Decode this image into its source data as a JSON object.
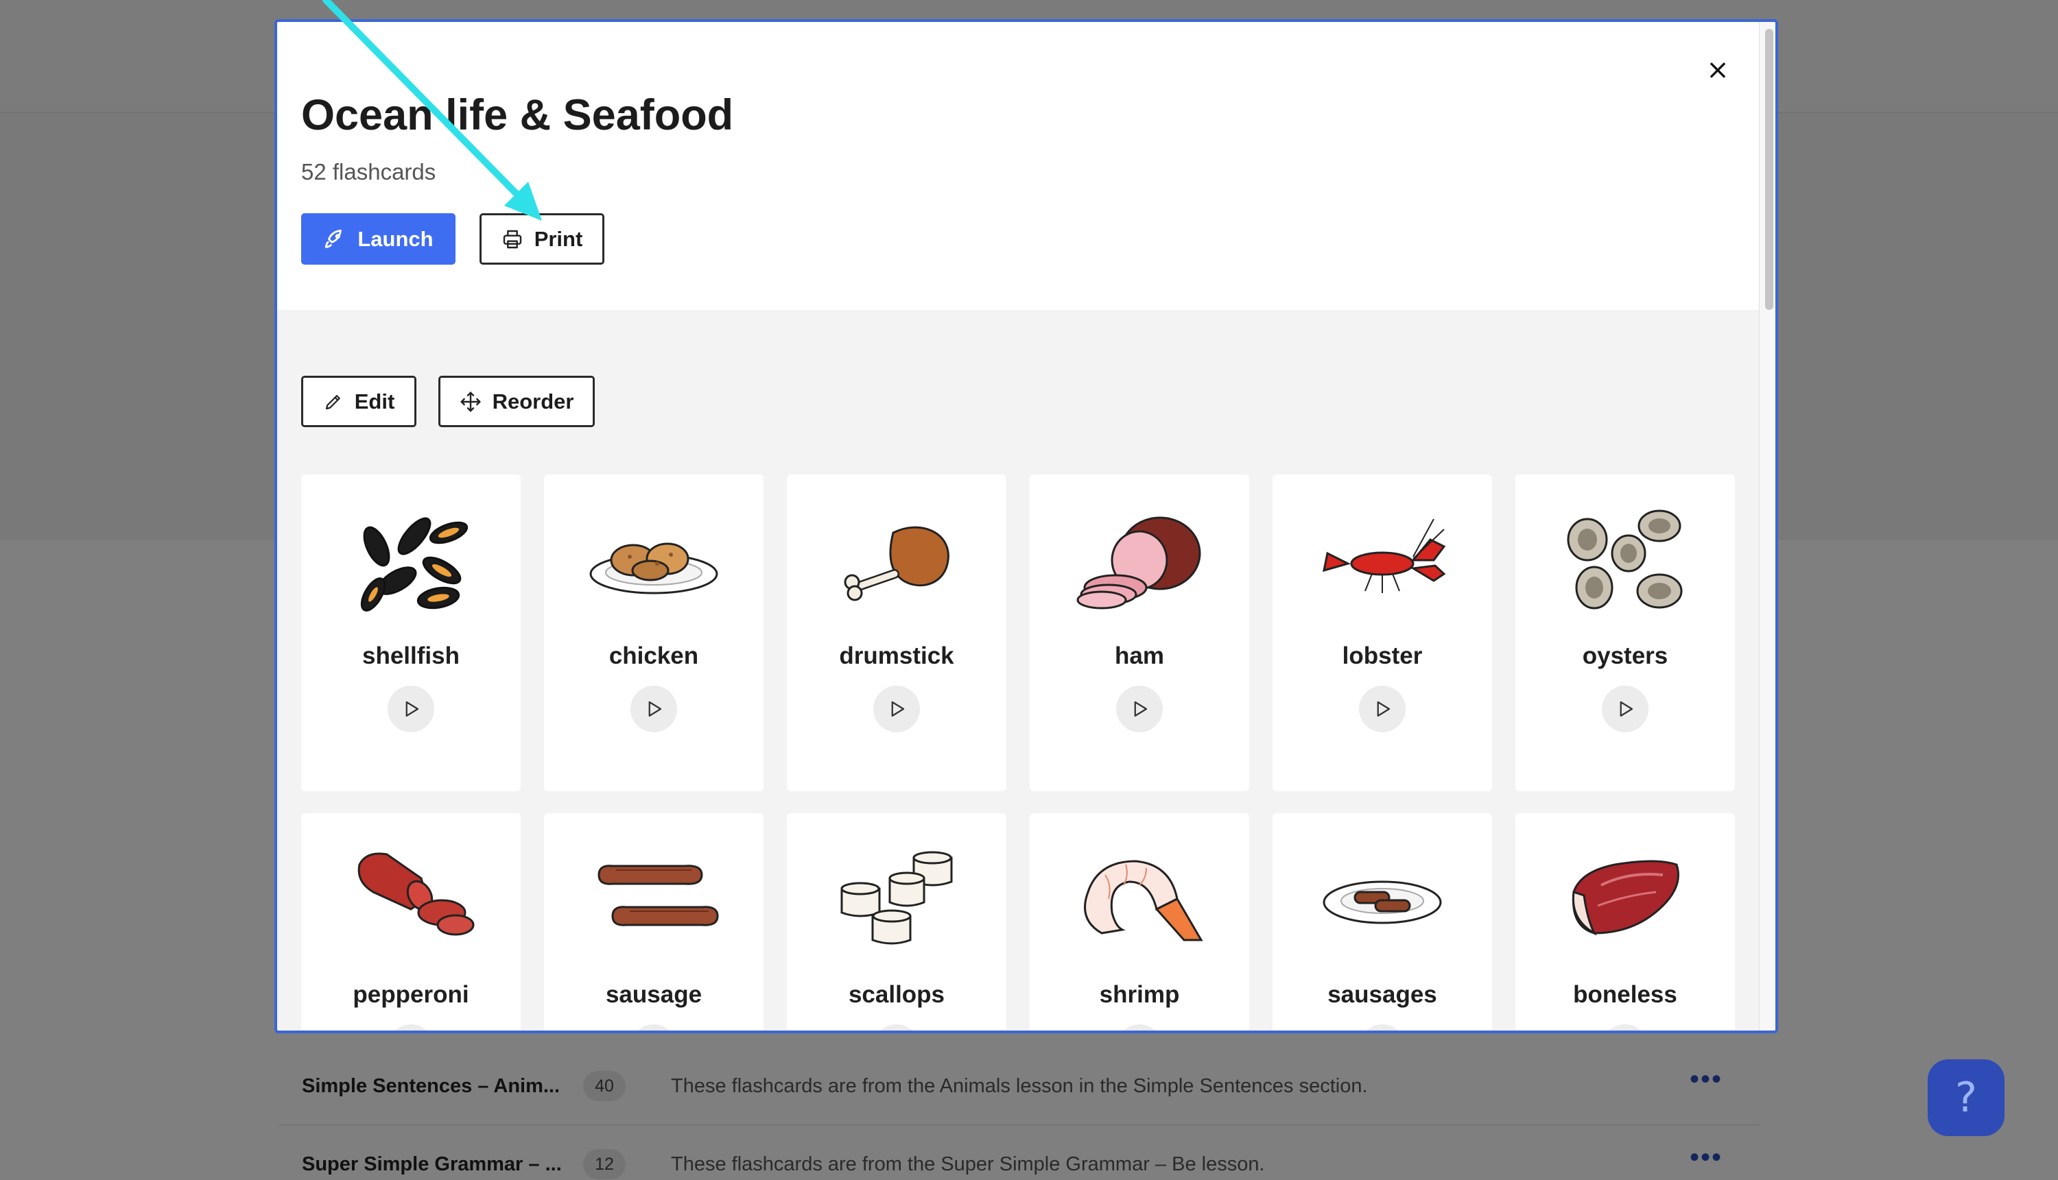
{
  "background": {
    "rows": [
      {
        "title": "Simple Sentences – Anim...",
        "count": "40",
        "description": "These flashcards are from the Animals lesson in the Simple Sentences section."
      },
      {
        "title": "Super Simple Grammar – ...",
        "count": "12",
        "description": "These flashcards are from the Super Simple Grammar – Be lesson."
      }
    ],
    "more_label": "•••",
    "help_label": "?"
  },
  "modal": {
    "title": "Ocean life & Seafood",
    "subtitle": "52 flashcards",
    "close_label": "×",
    "launch_label": "Launch",
    "print_label": "Print",
    "edit_label": "Edit",
    "reorder_label": "Reorder"
  },
  "cards": [
    {
      "label": "shellfish",
      "icon": "mussels-image"
    },
    {
      "label": "chicken",
      "icon": "fried-chicken-image"
    },
    {
      "label": "drumstick",
      "icon": "drumstick-image"
    },
    {
      "label": "ham",
      "icon": "ham-image"
    },
    {
      "label": "lobster",
      "icon": "lobster-image"
    },
    {
      "label": "oysters",
      "icon": "oysters-image"
    },
    {
      "label": "pepperoni",
      "icon": "pepperoni-image"
    },
    {
      "label": "sausage",
      "icon": "sausage-image"
    },
    {
      "label": "scallops",
      "icon": "scallops-image"
    },
    {
      "label": "shrimp",
      "icon": "shrimp-image"
    },
    {
      "label": "sausages",
      "icon": "sausages-plate-image"
    },
    {
      "label": "boneless",
      "icon": "boneless-meat-image"
    }
  ],
  "colors": {
    "accent": "#3f6df2",
    "modal_border": "#3a66d6",
    "annotation_arrow": "#2fe0e8",
    "help_button": "#2f4bb5"
  }
}
